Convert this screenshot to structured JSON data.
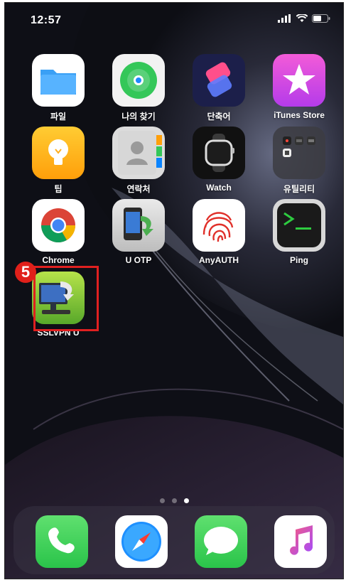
{
  "status_bar": {
    "time": "12:57"
  },
  "apps": [
    {
      "label": "파일",
      "icon": "files-icon"
    },
    {
      "label": "나의 찾기",
      "icon": "find-my-icon"
    },
    {
      "label": "단축어",
      "icon": "shortcuts-icon"
    },
    {
      "label": "iTunes Store",
      "icon": "itunes-store-icon"
    },
    {
      "label": "팁",
      "icon": "tips-icon"
    },
    {
      "label": "연락처",
      "icon": "contacts-icon"
    },
    {
      "label": "Watch",
      "icon": "watch-icon"
    },
    {
      "label": "유틸리티",
      "icon": "utilities-folder-icon"
    },
    {
      "label": "Chrome",
      "icon": "chrome-icon"
    },
    {
      "label": "U OTP",
      "icon": "u-otp-icon"
    },
    {
      "label": "AnyAUTH",
      "icon": "fingerprint-icon"
    },
    {
      "label": "Ping",
      "icon": "terminal-icon"
    },
    {
      "label": "SSLVPN U",
      "icon": "sslvpn-icon"
    }
  ],
  "step_marker": "5",
  "page_indicator": {
    "pages": 3,
    "current": 3
  },
  "dock": [
    {
      "name": "phone",
      "icon": "phone-icon"
    },
    {
      "name": "safari",
      "icon": "safari-icon"
    },
    {
      "name": "messages",
      "icon": "messages-icon"
    },
    {
      "name": "music",
      "icon": "music-icon"
    }
  ],
  "colors": {
    "highlight": "#e02020",
    "step_badge": "#e0201a"
  }
}
